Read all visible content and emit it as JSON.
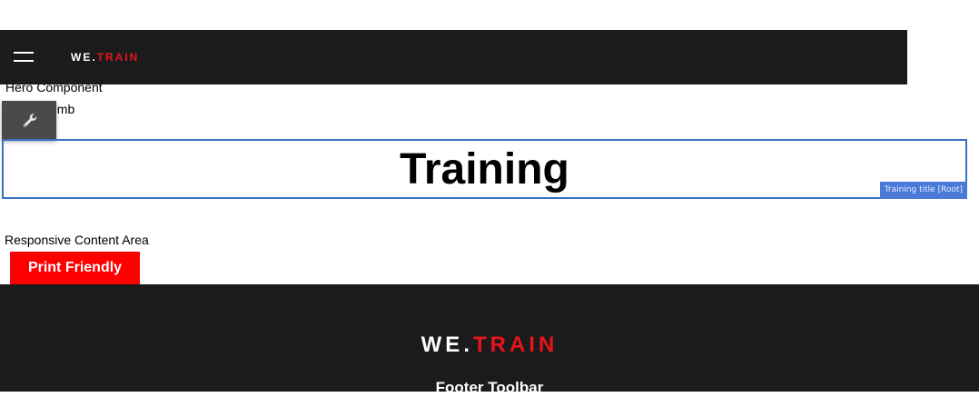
{
  "header": {
    "brand": {
      "we": "WE",
      "dot": ".",
      "train": "TRAIN"
    },
    "menu_icon": "hamburger-menu-icon"
  },
  "component_labels": {
    "hero": "Hero Component",
    "breadcrumb": "Breadcrumb",
    "content_area": "Responsive Content Area"
  },
  "tool_button": {
    "icon": "wrench-icon"
  },
  "title": {
    "text": "Training",
    "tag": "Training title [Root]"
  },
  "print_button": {
    "label": "Print Friendly"
  },
  "footer": {
    "brand": {
      "we": "WE",
      "dot": ".",
      "train": "TRAIN"
    },
    "toolbar_label": "Footer Toolbar"
  },
  "colors": {
    "bar_background": "#1b1b1b",
    "brand_red": "#e8141c",
    "print_button": "#fe0000",
    "editor_outline": "#3a6fc4",
    "editor_tag": "#4a79d8",
    "tool_button": "#4a4a4a"
  }
}
